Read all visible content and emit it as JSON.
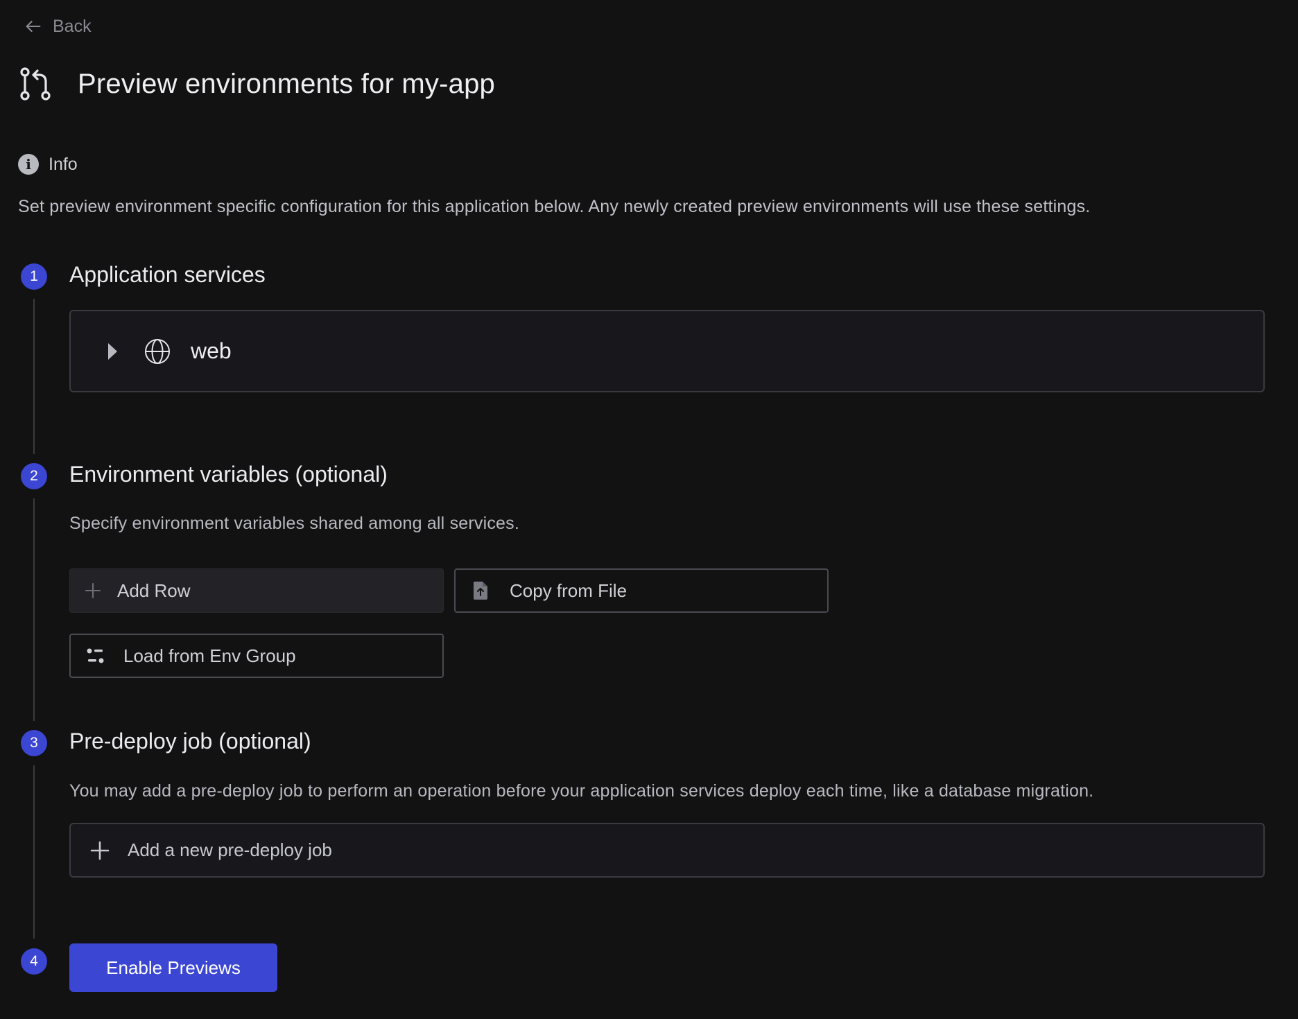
{
  "nav": {
    "back_label": "Back"
  },
  "header": {
    "title": "Preview environments for my-app"
  },
  "info": {
    "label": "Info",
    "description": "Set preview environment specific configuration for this application below. Any newly created preview environments will use these settings."
  },
  "steps": [
    {
      "number": "1",
      "title": "Application services"
    },
    {
      "number": "2",
      "title": "Environment variables (optional)",
      "description": "Specify environment variables shared among all services."
    },
    {
      "number": "3",
      "title": "Pre-deploy job (optional)",
      "description": "You may add a pre-deploy job to perform an operation before your application services deploy each time, like a database migration."
    },
    {
      "number": "4"
    }
  ],
  "services": [
    {
      "name": "web",
      "icon": "globe-icon"
    }
  ],
  "env_vars": {
    "add_row_label": "Add Row",
    "copy_from_file_label": "Copy from File",
    "load_from_env_group_label": "Load from Env Group"
  },
  "predeploy": {
    "add_label": "Add a new pre-deploy job"
  },
  "actions": {
    "enable_label": "Enable Previews"
  },
  "colors": {
    "background": "#121213",
    "accent": "#3b46d2",
    "card": "#18181c",
    "border": "#3a3a40"
  }
}
